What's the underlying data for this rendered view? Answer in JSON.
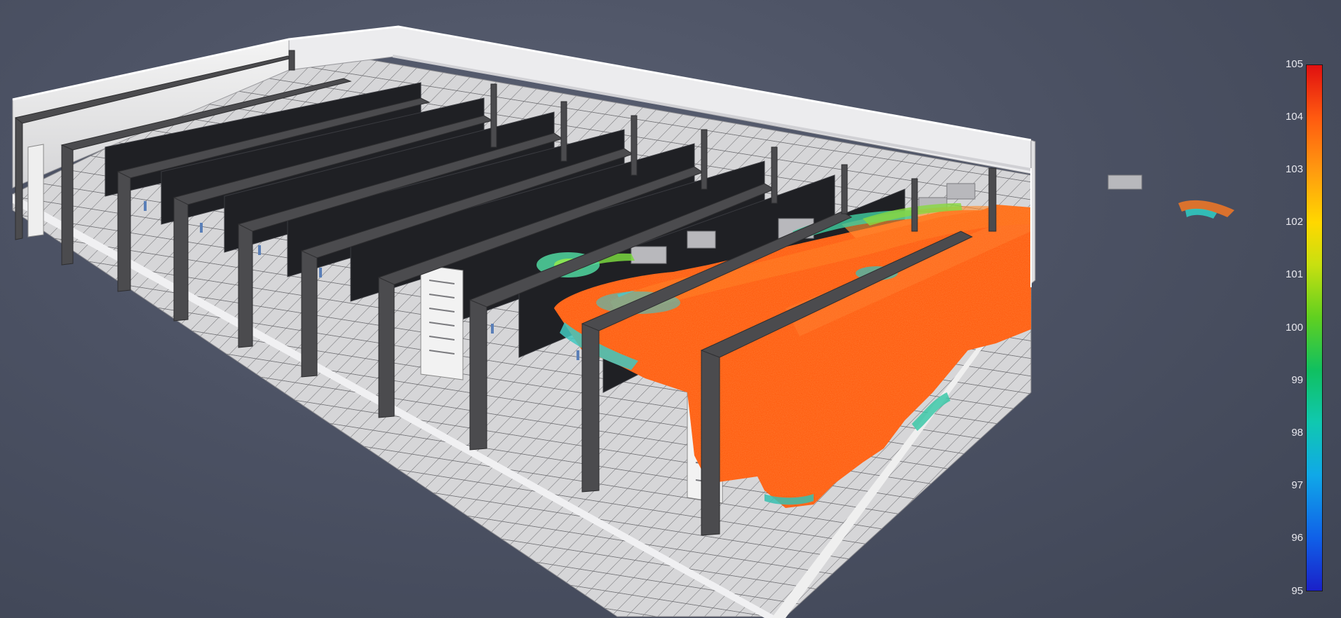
{
  "view": {
    "background": "#4c5264"
  },
  "legend": {
    "ticks": [
      "105",
      "104",
      "103",
      "102",
      "101",
      "100",
      "99",
      "98",
      "97",
      "96",
      "95"
    ],
    "colors": {
      "high": "#e01010",
      "mid_high": "#ff9a10",
      "mid": "#60d020",
      "mid_low": "#10a8e8",
      "low": "#1a20c8"
    }
  },
  "scene": {
    "description_icon": "data-center-3d-model-icon",
    "plume_color": "#ff5a10",
    "floor_color": "#d8d8d8",
    "beam_color": "#4a4a4c"
  }
}
